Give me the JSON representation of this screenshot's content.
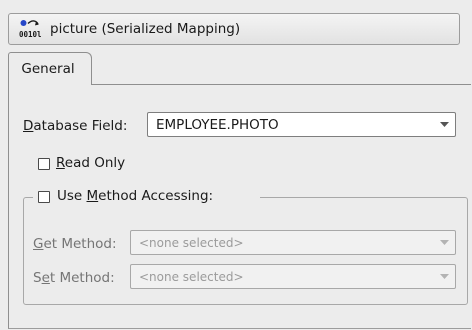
{
  "header": {
    "title": "picture (Serialized Mapping)",
    "icon": "binary-mapping-icon"
  },
  "tabs": [
    {
      "label": "General",
      "selected": true
    }
  ],
  "form": {
    "database_field": {
      "label_prefix": "",
      "label_mnemonic": "D",
      "label_rest": "atabase Field:",
      "value": "EMPLOYEE.PHOTO"
    },
    "read_only": {
      "label_mnemonic": "R",
      "label_rest": "ead Only",
      "checked": false
    },
    "use_method_accessing": {
      "label_prefix": "Use ",
      "label_mnemonic": "M",
      "label_rest": "ethod Accessing:",
      "checked": false
    },
    "get_method": {
      "label_mnemonic": "G",
      "label_rest": "et Method:",
      "value": "<none selected>",
      "enabled": false
    },
    "set_method": {
      "label_prefix": "S",
      "label_mnemonic": "e",
      "label_rest": "t Method:",
      "value": "<none selected>",
      "enabled": false
    }
  }
}
